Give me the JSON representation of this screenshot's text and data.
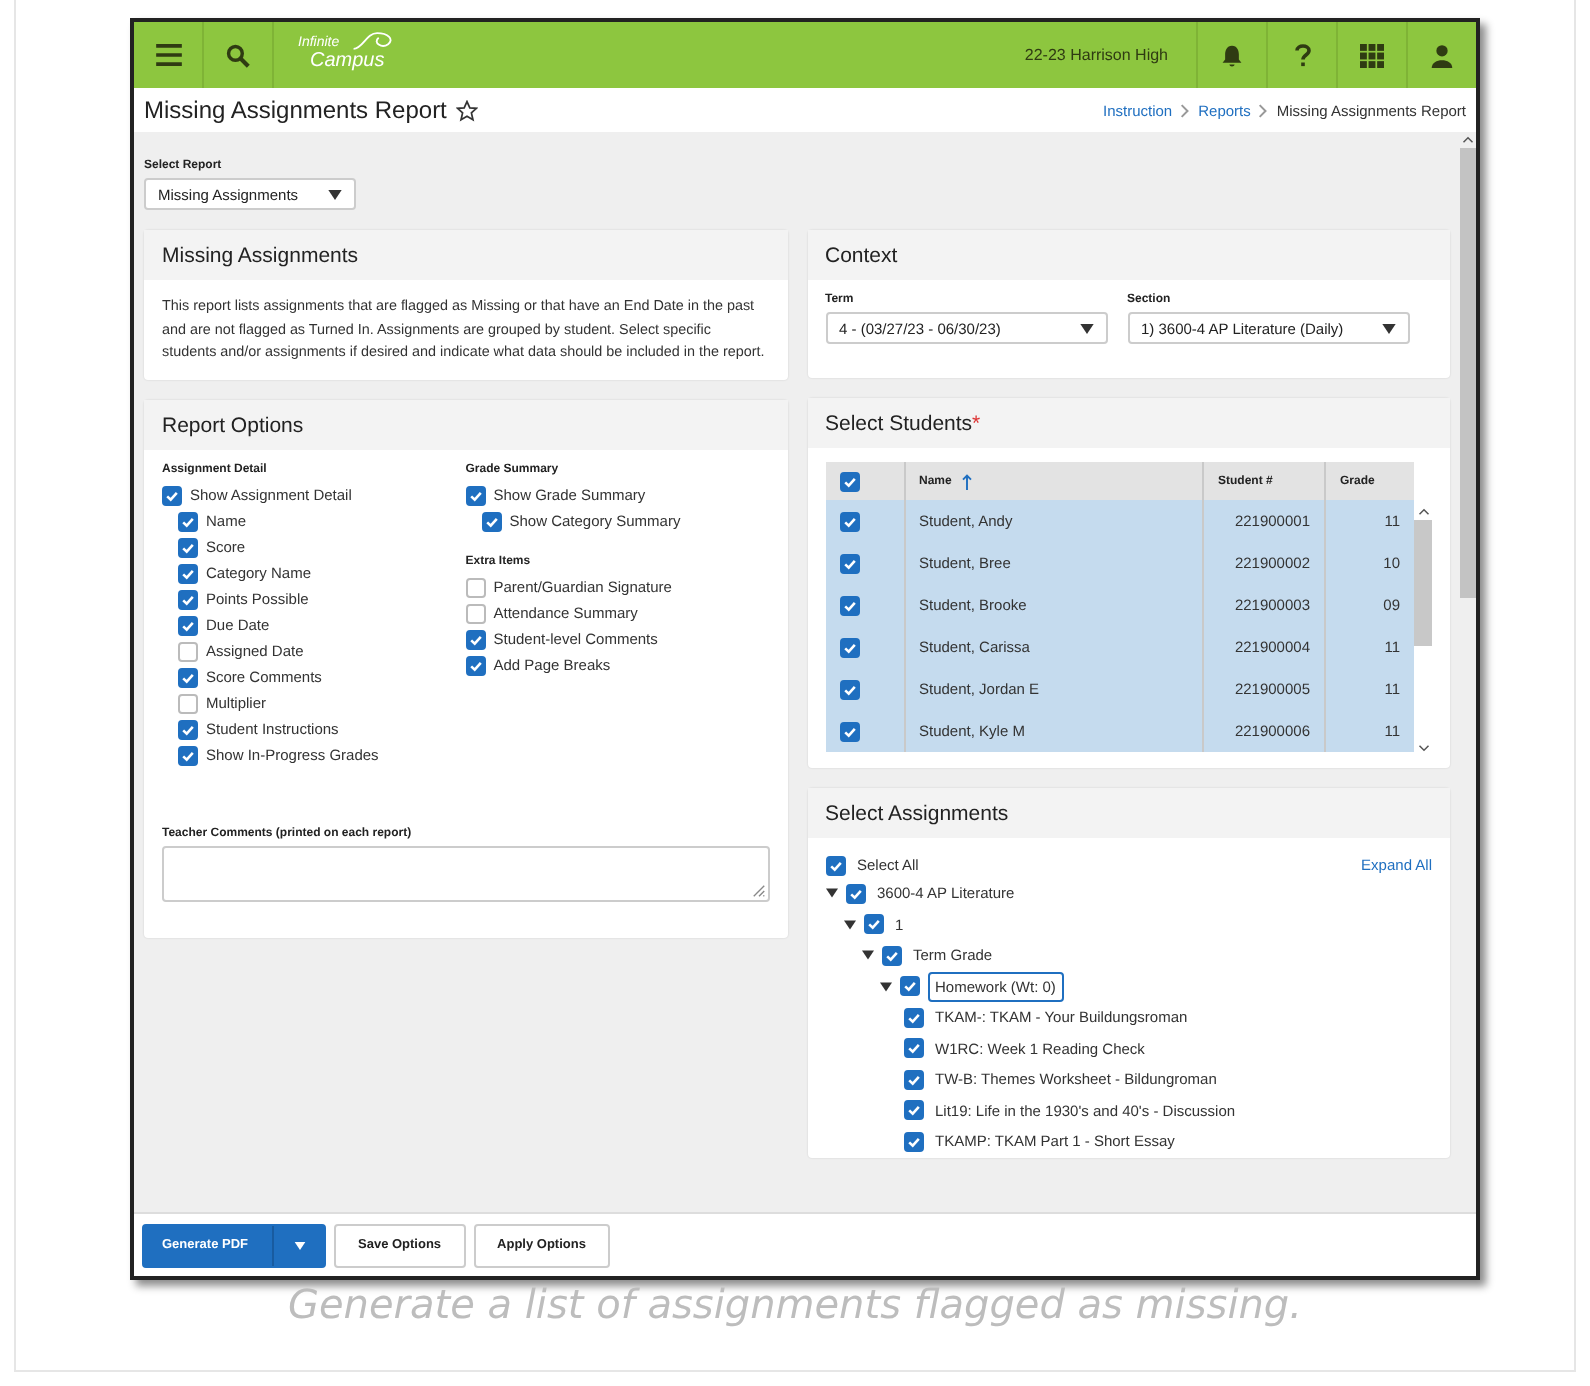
{
  "header": {
    "logo_top": "Infinite",
    "logo_bottom": "Campus",
    "school": "22-23 Harrison High"
  },
  "page": {
    "title": "Missing Assignments Report",
    "breadcrumbs": [
      {
        "label": "Instruction",
        "link": true
      },
      {
        "label": "Reports",
        "link": true
      },
      {
        "label": "Missing Assignments Report",
        "link": false
      }
    ]
  },
  "select_report": {
    "label": "Select Report",
    "value": "Missing Assignments"
  },
  "description_panel": {
    "title": "Missing Assignments",
    "text": "This report lists assignments that are flagged as Missing or that have an End Date in the past and are not flagged as Turned In. Assignments are grouped by student. Select specific students and/or assignments if desired and indicate what data should be included in the report."
  },
  "report_options": {
    "title": "Report Options",
    "columns": [
      [
        {
          "heading": "Assignment Detail",
          "items": [
            {
              "label": "Show Assignment Detail",
              "checked": true,
              "children": [
                {
                  "label": "Name",
                  "checked": true
                },
                {
                  "label": "Score",
                  "checked": true
                },
                {
                  "label": "Category Name",
                  "checked": true
                },
                {
                  "label": "Points Possible",
                  "checked": true
                },
                {
                  "label": "Due Date",
                  "checked": true
                },
                {
                  "label": "Assigned Date",
                  "checked": false
                },
                {
                  "label": "Score Comments",
                  "checked": true
                },
                {
                  "label": "Multiplier",
                  "checked": false
                },
                {
                  "label": "Student Instructions",
                  "checked": true
                },
                {
                  "label": "Show In-Progress Grades",
                  "checked": true
                }
              ]
            }
          ]
        }
      ],
      [
        {
          "heading": "Grade Summary",
          "items": [
            {
              "label": "Show Grade Summary",
              "checked": true,
              "children": [
                {
                  "label": "Show Category Summary",
                  "checked": true
                }
              ]
            }
          ]
        },
        {
          "heading": "Extra Items",
          "items": [
            {
              "label": "Parent/Guardian Signature",
              "checked": false
            },
            {
              "label": "Attendance Summary",
              "checked": false
            },
            {
              "label": "Student-level Comments",
              "checked": true
            },
            {
              "label": "Add Page Breaks",
              "checked": true
            }
          ]
        }
      ]
    ],
    "comments_label": "Teacher Comments (printed on each report)"
  },
  "context": {
    "title": "Context",
    "fields": [
      {
        "label": "Term",
        "value": "4 - (03/27/23 - 06/30/23)"
      },
      {
        "label": "Section",
        "value": "1) 3600-4 AP Literature (Daily)"
      }
    ]
  },
  "students": {
    "title": "Select Students",
    "required_mark": "*",
    "all_checked": true,
    "columns": [
      "Name",
      "Student #",
      "Grade"
    ],
    "rows": [
      {
        "name": "Student, Andy",
        "number": "221900001",
        "grade": "11",
        "checked": true,
        "selected": true
      },
      {
        "name": "Student, Bree",
        "number": "221900002",
        "grade": "10",
        "checked": true,
        "selected": true
      },
      {
        "name": "Student, Brooke",
        "number": "221900003",
        "grade": "09",
        "checked": true,
        "selected": true
      },
      {
        "name": "Student, Carissa",
        "number": "221900004",
        "grade": "11",
        "checked": true,
        "selected": true
      },
      {
        "name": "Student, Jordan E",
        "number": "221900005",
        "grade": "11",
        "checked": true,
        "selected": true
      },
      {
        "name": "Student, Kyle M",
        "number": "221900006",
        "grade": "11",
        "checked": true,
        "selected": true
      }
    ]
  },
  "assignments": {
    "title": "Select Assignments",
    "select_all": {
      "label": "Select All",
      "checked": true
    },
    "expand_all": "Expand All",
    "tree": [
      {
        "label": "3600-4 AP Literature",
        "checked": true,
        "expanded": true,
        "children": [
          {
            "label": "1",
            "checked": true,
            "expanded": true,
            "children": [
              {
                "label": "Term Grade",
                "checked": true,
                "expanded": true,
                "children": [
                  {
                    "label": "Homework (Wt: 0)",
                    "checked": true,
                    "expanded": true,
                    "focused": true,
                    "children": [
                      {
                        "label": "TKAM-: TKAM - Your Buildungsroman",
                        "checked": true
                      },
                      {
                        "label": "W1RC: Week 1 Reading Check",
                        "checked": true
                      },
                      {
                        "label": "TW-B: Themes Worksheet - Bildungroman",
                        "checked": true
                      },
                      {
                        "label": "Lit19: Life in the 1930's and 40's - Discussion",
                        "checked": true
                      },
                      {
                        "label": "TKAMP: TKAM Part 1 - Short Essay",
                        "checked": true
                      }
                    ]
                  }
                ]
              }
            ]
          }
        ]
      }
    ]
  },
  "footer": {
    "buttons": [
      {
        "label": "Generate PDF",
        "kind": "primary"
      },
      {
        "label": "Save Options",
        "kind": "secondary"
      },
      {
        "label": "Apply Options",
        "kind": "secondary"
      }
    ]
  },
  "caption": "Generate a list of assignments flagged as missing."
}
